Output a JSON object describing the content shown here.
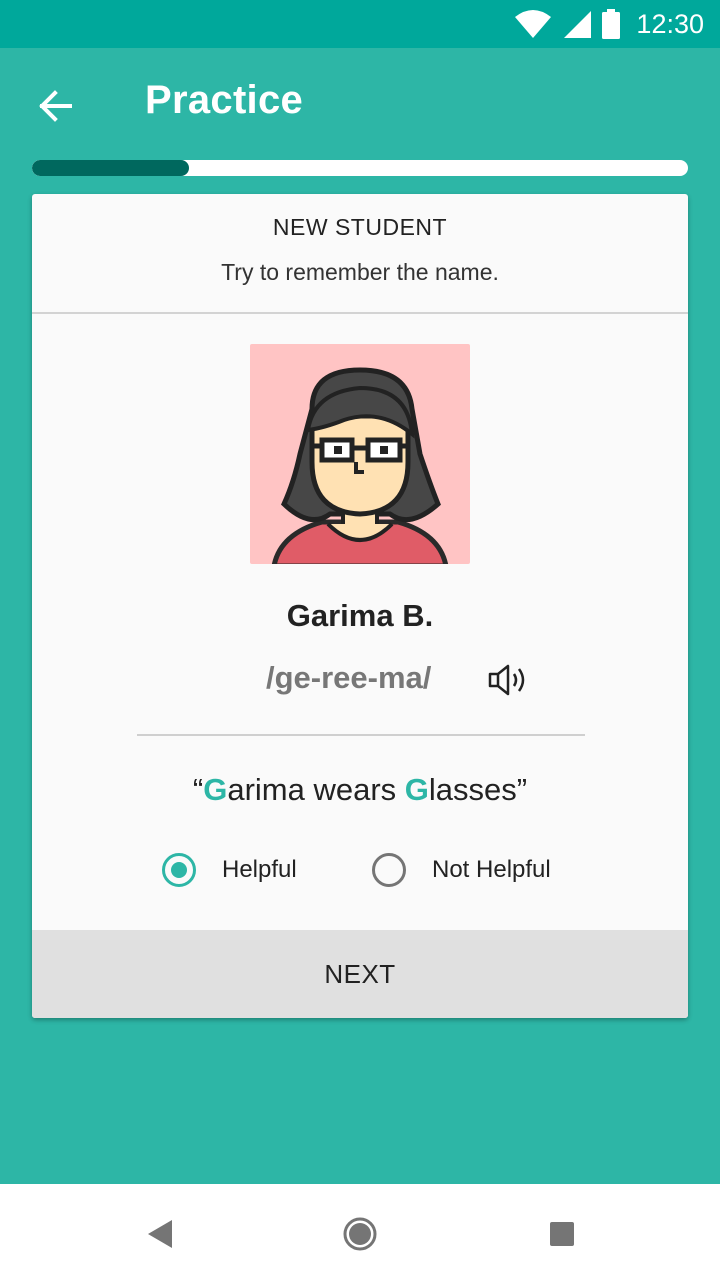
{
  "status_bar": {
    "time": "12:30",
    "icons": [
      "wifi-icon",
      "signal-icon",
      "battery-icon"
    ]
  },
  "app_bar": {
    "title": "Practice",
    "back_icon": "arrow-left-icon"
  },
  "progress": {
    "fraction": 0.24
  },
  "card": {
    "label": "NEW STUDENT",
    "instruction": "Try to remember the name.",
    "student": {
      "name": "Garima B.",
      "pronunciation": "/ge-ree-ma/"
    },
    "mnemonic": {
      "parts": [
        {
          "text": "“",
          "highlight": false
        },
        {
          "text": "G",
          "highlight": true
        },
        {
          "text": "arima wears ",
          "highlight": false
        },
        {
          "text": "G",
          "highlight": true
        },
        {
          "text": "lasses”",
          "highlight": false
        }
      ]
    },
    "options": [
      {
        "label": "Helpful",
        "selected": true
      },
      {
        "label": "Not Helpful",
        "selected": false
      }
    ],
    "next_label": "NEXT"
  },
  "colors": {
    "accent": "#2db6a6",
    "status_bar": "#00a89b",
    "progress_fill": "#00685e"
  }
}
